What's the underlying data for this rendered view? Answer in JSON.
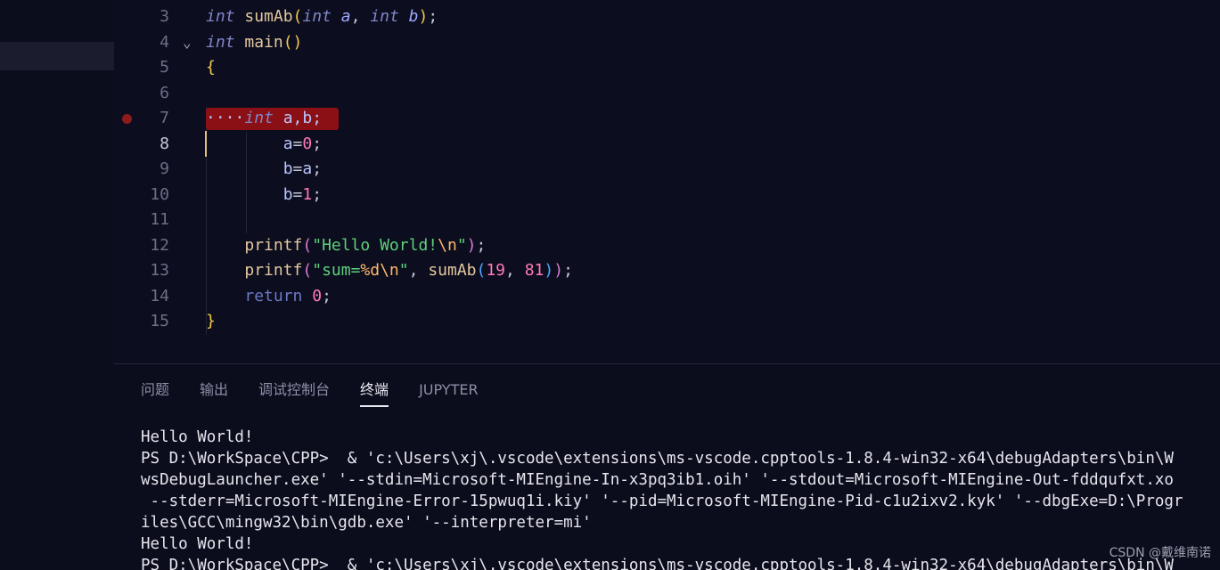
{
  "editor": {
    "lines": [
      {
        "no": "3",
        "segments": [
          {
            "t": "int",
            "c": "kw"
          },
          {
            "t": " ",
            "c": "plain"
          },
          {
            "t": "sumAb",
            "c": "fn"
          },
          {
            "t": "(",
            "c": "paren"
          },
          {
            "t": "int",
            "c": "kw"
          },
          {
            "t": " ",
            "c": "plain"
          },
          {
            "t": "a",
            "c": "var"
          },
          {
            "t": ", ",
            "c": "punc"
          },
          {
            "t": "int",
            "c": "kw"
          },
          {
            "t": " ",
            "c": "plain"
          },
          {
            "t": "b",
            "c": "var"
          },
          {
            "t": ")",
            "c": "paren"
          },
          {
            "t": ";",
            "c": "punc"
          }
        ]
      },
      {
        "no": "4",
        "fold": "⌄",
        "segments": [
          {
            "t": "int",
            "c": "kw"
          },
          {
            "t": " ",
            "c": "plain"
          },
          {
            "t": "main",
            "c": "fn"
          },
          {
            "t": "()",
            "c": "paren"
          }
        ]
      },
      {
        "no": "5",
        "segments": [
          {
            "t": "{",
            "c": "paren"
          }
        ]
      },
      {
        "no": "6",
        "segments": []
      },
      {
        "no": "7",
        "breakpoint": true,
        "segments": [
          {
            "t": "····",
            "c": "plain"
          },
          {
            "t": "int",
            "c": "kw"
          },
          {
            "t": " a,b;",
            "c": "plain"
          }
        ]
      },
      {
        "no": "8",
        "active": true,
        "segments": [
          {
            "t": "        a",
            "c": "plain"
          },
          {
            "t": "=",
            "c": "punc"
          },
          {
            "t": "0",
            "c": "num"
          },
          {
            "t": ";",
            "c": "punc"
          }
        ]
      },
      {
        "no": "9",
        "segments": [
          {
            "t": "        b",
            "c": "plain"
          },
          {
            "t": "=",
            "c": "punc"
          },
          {
            "t": "a",
            "c": "plain"
          },
          {
            "t": ";",
            "c": "punc"
          }
        ]
      },
      {
        "no": "10",
        "segments": [
          {
            "t": "        b",
            "c": "plain"
          },
          {
            "t": "=",
            "c": "punc"
          },
          {
            "t": "1",
            "c": "num"
          },
          {
            "t": ";",
            "c": "punc"
          }
        ]
      },
      {
        "no": "11",
        "segments": []
      },
      {
        "no": "12",
        "segments": [
          {
            "t": "    ",
            "c": "plain"
          },
          {
            "t": "printf",
            "c": "fn"
          },
          {
            "t": "(",
            "c": "paren2"
          },
          {
            "t": "\"Hello World!",
            "c": "str"
          },
          {
            "t": "\\n",
            "c": "esc"
          },
          {
            "t": "\"",
            "c": "str"
          },
          {
            "t": ")",
            "c": "paren2"
          },
          {
            "t": ";",
            "c": "punc"
          }
        ]
      },
      {
        "no": "13",
        "segments": [
          {
            "t": "    ",
            "c": "plain"
          },
          {
            "t": "printf",
            "c": "fn"
          },
          {
            "t": "(",
            "c": "paren2"
          },
          {
            "t": "\"sum=",
            "c": "str"
          },
          {
            "t": "%d\\n",
            "c": "esc"
          },
          {
            "t": "\"",
            "c": "str"
          },
          {
            "t": ", ",
            "c": "punc"
          },
          {
            "t": "sumAb",
            "c": "fn"
          },
          {
            "t": "(",
            "c": "paren3"
          },
          {
            "t": "19",
            "c": "num"
          },
          {
            "t": ", ",
            "c": "punc"
          },
          {
            "t": "81",
            "c": "num"
          },
          {
            "t": ")",
            "c": "paren3"
          },
          {
            "t": ")",
            "c": "paren2"
          },
          {
            "t": ";",
            "c": "punc"
          }
        ]
      },
      {
        "no": "14",
        "segments": [
          {
            "t": "    ",
            "c": "plain"
          },
          {
            "t": "return",
            "c": "kw2"
          },
          {
            "t": " ",
            "c": "plain"
          },
          {
            "t": "0",
            "c": "num"
          },
          {
            "t": ";",
            "c": "punc"
          }
        ]
      },
      {
        "no": "15",
        "segments": [
          {
            "t": "}",
            "c": "paren"
          }
        ]
      }
    ]
  },
  "panel": {
    "tabs": [
      {
        "label": "问题",
        "active": false
      },
      {
        "label": "输出",
        "active": false
      },
      {
        "label": "调试控制台",
        "active": false
      },
      {
        "label": "终端",
        "active": true
      },
      {
        "label": "JUPYTER",
        "active": false
      }
    ],
    "terminal_lines": [
      "Hello World!",
      "PS D:\\WorkSpace\\CPP>  & 'c:\\Users\\xj\\.vscode\\extensions\\ms-vscode.cpptools-1.8.4-win32-x64\\debugAdapters\\bin\\W",
      "wsDebugLauncher.exe' '--stdin=Microsoft-MIEngine-In-x3pq3ib1.oih' '--stdout=Microsoft-MIEngine-Out-fddqufxt.xo",
      " --stderr=Microsoft-MIEngine-Error-15pwuq1i.kiy' '--pid=Microsoft-MIEngine-Pid-c1u2ixv2.kyk' '--dbgExe=D:\\Progr",
      "iles\\GCC\\mingw32\\bin\\gdb.exe' '--interpreter=mi'",
      "Hello World!",
      "PS D:\\WorkSpace\\CPP>  & 'c:\\Users\\xj\\.vscode\\extensions\\ms-vscode.cpptools-1.8.4-win32-x64\\debugAdapters\\bin\\W"
    ]
  },
  "watermark": "CSDN @戴维南诺"
}
